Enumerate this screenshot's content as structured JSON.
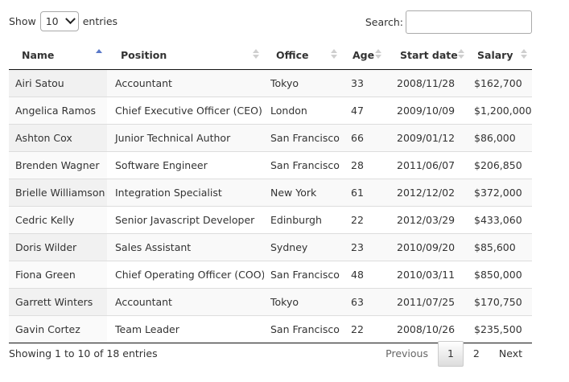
{
  "length": {
    "show_label": "Show",
    "selected": "10",
    "entries_label": "entries"
  },
  "search": {
    "label": "Search:",
    "value": ""
  },
  "table": {
    "columns": [
      "Name",
      "Position",
      "Office",
      "Age",
      "Start date",
      "Salary"
    ],
    "sorted_column": "Name",
    "sort_direction": "ascending",
    "rows": [
      [
        "Airi Satou",
        "Accountant",
        "Tokyo",
        "33",
        "2008/11/28",
        "$162,700"
      ],
      [
        "Angelica Ramos",
        "Chief Executive Officer (CEO)",
        "London",
        "47",
        "2009/10/09",
        "$1,200,000"
      ],
      [
        "Ashton Cox",
        "Junior Technical Author",
        "San Francisco",
        "66",
        "2009/01/12",
        "$86,000"
      ],
      [
        "Brenden Wagner",
        "Software Engineer",
        "San Francisco",
        "28",
        "2011/06/07",
        "$206,850"
      ],
      [
        "Brielle Williamson",
        "Integration Specialist",
        "New York",
        "61",
        "2012/12/02",
        "$372,000"
      ],
      [
        "Cedric Kelly",
        "Senior Javascript Developer",
        "Edinburgh",
        "22",
        "2012/03/29",
        "$433,060"
      ],
      [
        "Doris Wilder",
        "Sales Assistant",
        "Sydney",
        "23",
        "2010/09/20",
        "$85,600"
      ],
      [
        "Fiona Green",
        "Chief Operating Officer (COO)",
        "San Francisco",
        "48",
        "2010/03/11",
        "$850,000"
      ],
      [
        "Garrett Winters",
        "Accountant",
        "Tokyo",
        "63",
        "2011/07/25",
        "$170,750"
      ],
      [
        "Gavin Cortez",
        "Team Leader",
        "San Francisco",
        "22",
        "2008/10/26",
        "$235,500"
      ]
    ]
  },
  "footer": {
    "info": "Showing 1 to 10 of 18 entries",
    "pagination": {
      "previous": "Previous",
      "pages": [
        "1",
        "2"
      ],
      "current_page": "1",
      "next": "Next"
    }
  },
  "colors": {
    "text": "#333333",
    "sort_active": "#5a79c8",
    "sort_inactive": "#cfcfcf",
    "row_stripe": "#f9f9f9",
    "border": "#dddddd"
  }
}
